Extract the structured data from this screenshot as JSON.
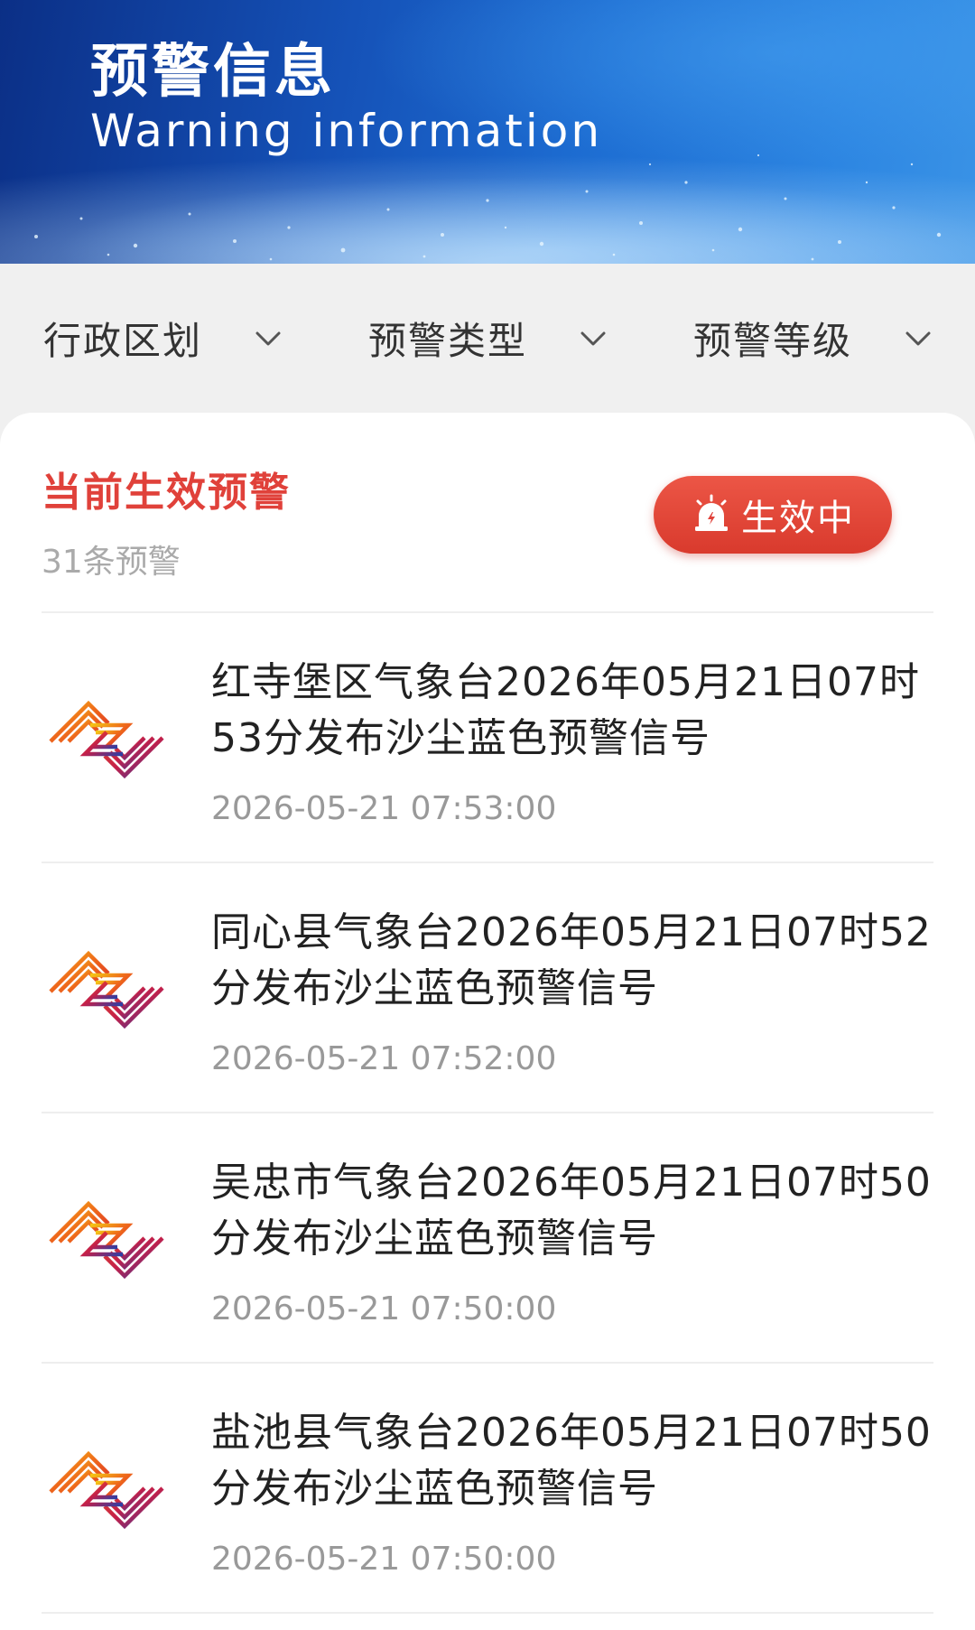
{
  "header": {
    "title": "预警信息",
    "subtitle": "Warning information"
  },
  "filters": [
    {
      "label": "行政区划",
      "icon": "chevron-down-icon"
    },
    {
      "label": "预警类型",
      "icon": "chevron-down-icon"
    },
    {
      "label": "预警等级",
      "icon": "chevron-down-icon"
    }
  ],
  "card": {
    "title": "当前生效预警",
    "count": "31条预警",
    "status_button": {
      "label": "生效中",
      "icon": "alarm-icon"
    }
  },
  "warnings": [
    {
      "title": "红寺堡区气象台2026年05月21日07时53分发布沙尘蓝色预警信号",
      "time": "2026-05-21 07:53:00",
      "icon": "warning-logo-icon"
    },
    {
      "title": "同心县气象台2026年05月21日07时52分发布沙尘蓝色预警信号",
      "time": "2026-05-21 07:52:00",
      "icon": "warning-logo-icon"
    },
    {
      "title": "吴忠市气象台2026年05月21日07时50分发布沙尘蓝色预警信号",
      "time": "2026-05-21 07:50:00",
      "icon": "warning-logo-icon"
    },
    {
      "title": "盐池县气象台2026年05月21日07时50分发布沙尘蓝色预警信号",
      "time": "2026-05-21 07:50:00",
      "icon": "warning-logo-icon"
    }
  ],
  "colors": {
    "accent_red": "#e0413a",
    "banner_blue": "#1552b8",
    "text_dark": "#222222",
    "text_muted": "#999999"
  }
}
